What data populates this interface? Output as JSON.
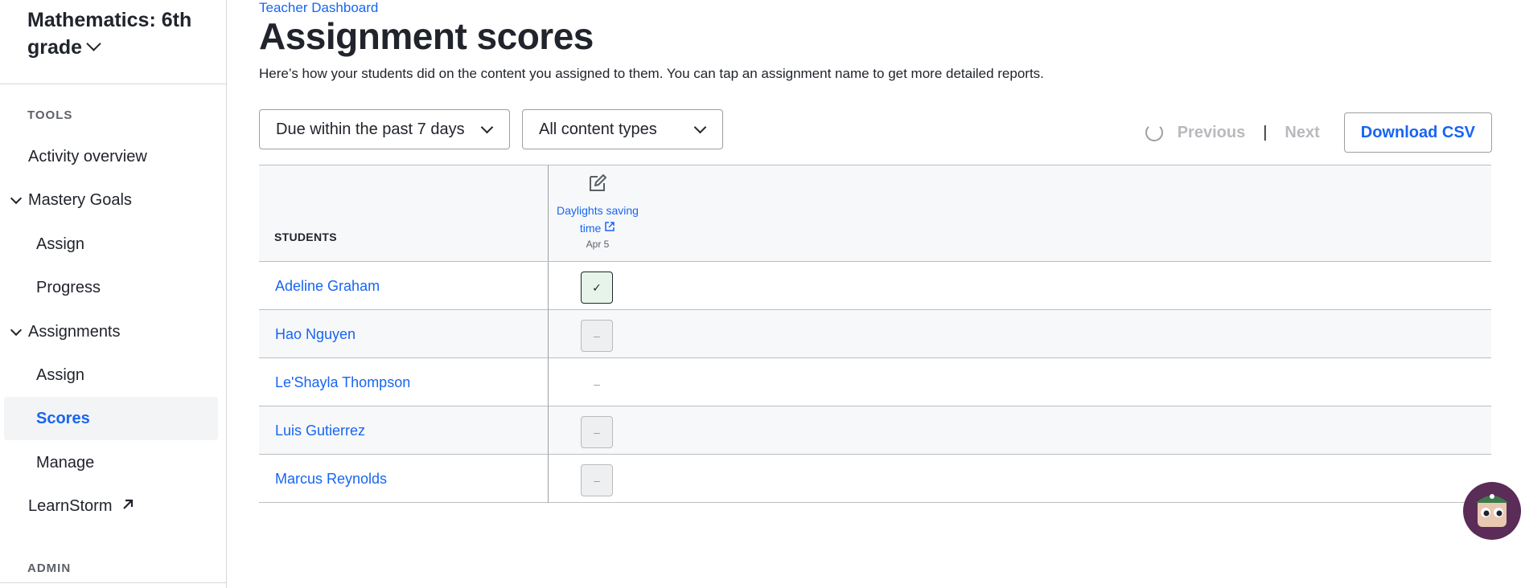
{
  "sidebar": {
    "course_title": "Mathematics: 6th grade",
    "tools_label": "TOOLS",
    "admin_label": "ADMIN",
    "items": [
      {
        "label": "Activity overview"
      },
      {
        "label": "Mastery Goals"
      },
      {
        "label": "Assign"
      },
      {
        "label": "Progress"
      },
      {
        "label": "Assignments"
      },
      {
        "label": "Assign"
      },
      {
        "label": "Scores"
      },
      {
        "label": "Manage"
      },
      {
        "label": "LearnStorm"
      }
    ]
  },
  "header": {
    "breadcrumb": "Teacher Dashboard",
    "title": "Assignment scores",
    "subtitle": "Here’s how your students did on the content you assigned to them. You can tap an assignment name to get more detailed reports."
  },
  "filters": {
    "due": "Due within the past 7 days",
    "content_type": "All content types"
  },
  "pager": {
    "previous": "Previous",
    "separator": "|",
    "next": "Next",
    "download": "Download CSV"
  },
  "table": {
    "students_header": "STUDENTS",
    "assignment": {
      "name": "Daylights saving time",
      "date": "Apr 5"
    },
    "rows": [
      {
        "student": "Adeline Graham",
        "status": "done",
        "mark": "✓"
      },
      {
        "student": "Hao Nguyen",
        "status": "pending",
        "mark": "–"
      },
      {
        "student": "Le'Shayla Thompson",
        "status": "none",
        "mark": "–"
      },
      {
        "student": "Luis Gutierrez",
        "status": "pending",
        "mark": "–"
      },
      {
        "student": "Marcus Reynolds",
        "status": "pending",
        "mark": "–"
      }
    ]
  },
  "icons": {
    "course_switcher": "chevron-down-icon",
    "external": "external-link-icon",
    "edit": "pencil-edit-icon",
    "loading": "spinner-icon",
    "helper": "helper-avatar-icon"
  }
}
